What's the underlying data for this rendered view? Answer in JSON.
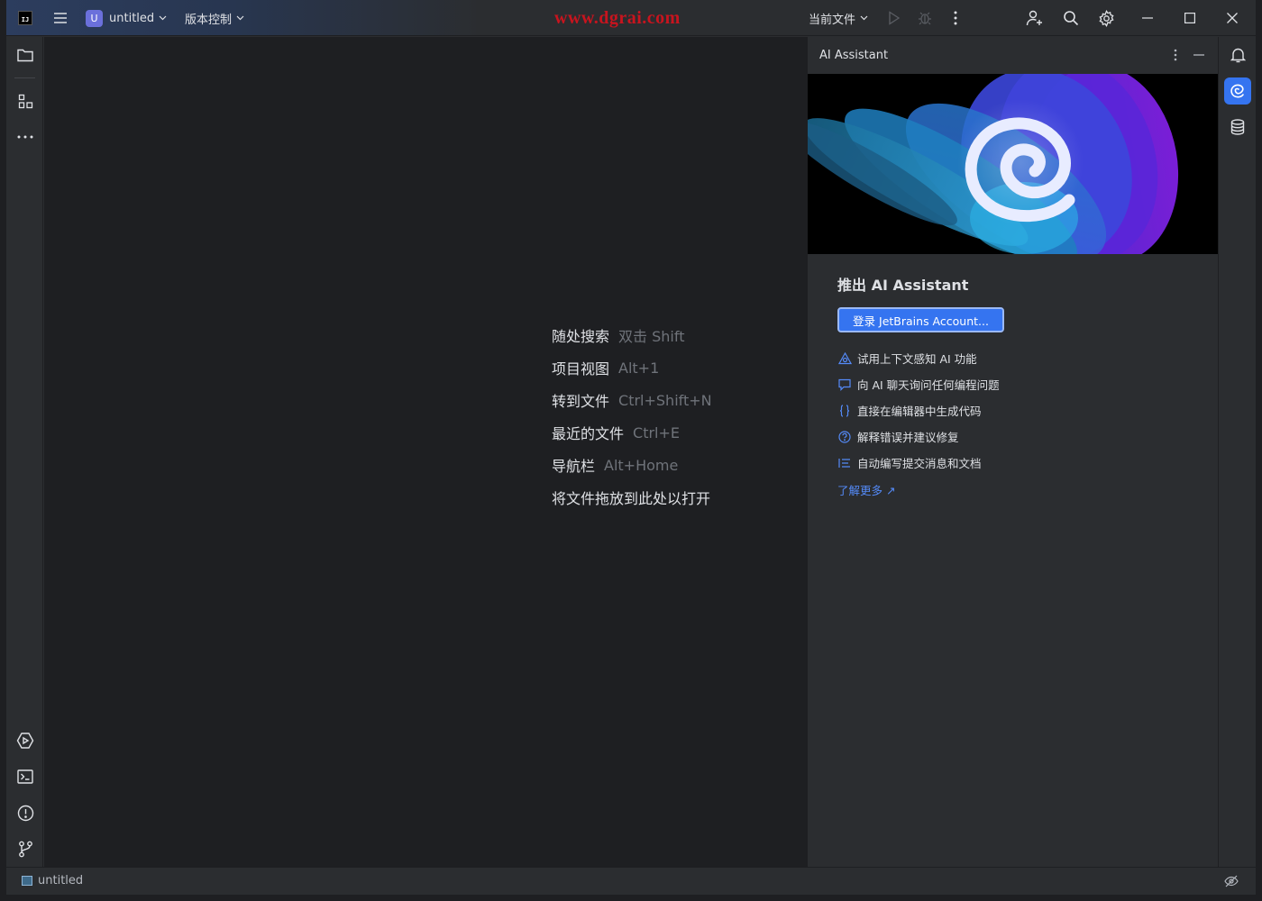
{
  "titlebar": {
    "project_badge": "U",
    "project_name": "untitled",
    "vcs_label": "版本控制",
    "watermark": "www.dgrai.com",
    "run_config": "当前文件",
    "icons": [
      "ide-logo",
      "main-menu-icon",
      "run-icon",
      "debug-icon",
      "more-icon",
      "add-user-icon",
      "search-icon",
      "settings-icon",
      "minimize-icon",
      "maximize-icon",
      "close-icon"
    ]
  },
  "left_stripe": {
    "icons": [
      "project-folder-icon",
      "structure-icon",
      "more-tools-icon",
      "services-icon",
      "terminal-icon",
      "problems-icon",
      "git-icon"
    ]
  },
  "editor": {
    "hints": [
      {
        "action": "随处搜索",
        "shortcut": "双击 Shift"
      },
      {
        "action": "项目视图",
        "shortcut": "Alt+1"
      },
      {
        "action": "转到文件",
        "shortcut": "Ctrl+Shift+N"
      },
      {
        "action": "最近的文件",
        "shortcut": "Ctrl+E"
      },
      {
        "action": "导航栏",
        "shortcut": "Alt+Home"
      },
      {
        "action": "将文件拖放到此处以打开",
        "shortcut": ""
      }
    ]
  },
  "ai_panel": {
    "title": "AI Assistant",
    "heading": "推出 AI Assistant",
    "login_button": "登录 JetBrains Account...",
    "features": [
      {
        "icon": "context-icon",
        "text": "试用上下文感知 AI 功能"
      },
      {
        "icon": "chat-icon",
        "text": "向 AI 聊天询问任何编程问题"
      },
      {
        "icon": "code-brackets-icon",
        "text": "直接在编辑器中生成代码"
      },
      {
        "icon": "question-icon",
        "text": "解释错误并建议修复"
      },
      {
        "icon": "commit-doc-icon",
        "text": "自动编写提交消息和文档"
      }
    ],
    "learn_more": "了解更多 ↗"
  },
  "right_stripe": {
    "icons": [
      "notifications-icon",
      "ai-assistant-icon",
      "database-icon"
    ]
  },
  "statusbar": {
    "project": "untitled"
  },
  "colors": {
    "accent": "#3574f0",
    "link": "#548af7",
    "watermark": "#c8141e",
    "editor_bg": "#1e1f22",
    "panel_bg": "#2b2d30"
  }
}
